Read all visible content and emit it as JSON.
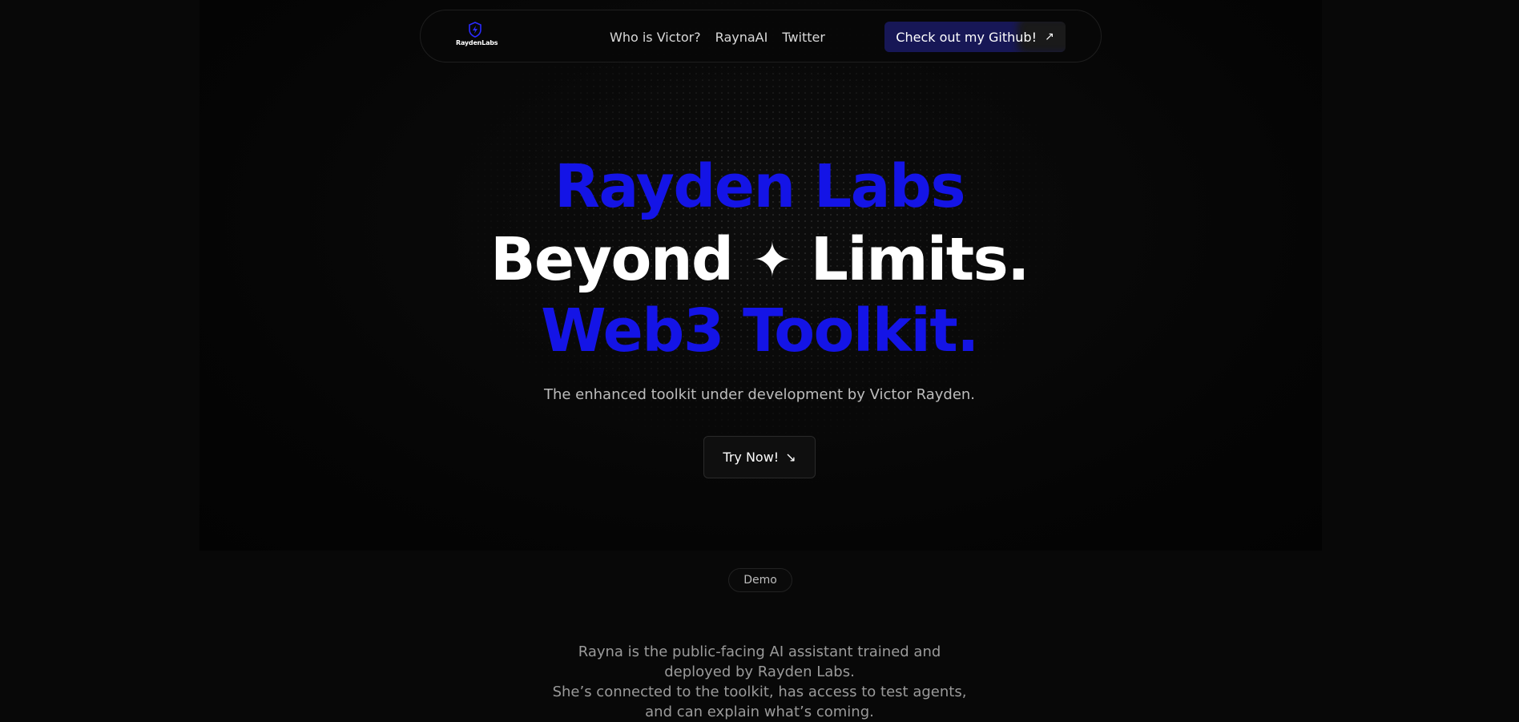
{
  "brand": {
    "logo_text": "RaydenLabs",
    "logo_icon": "shield-bolt-icon",
    "accent_color": "#1414e6"
  },
  "nav": {
    "links": [
      "Who is Victor?",
      "RaynaAI",
      "Twitter"
    ],
    "cta_label": "Check out my Github!",
    "cta_icon": "arrow-up-right-icon"
  },
  "hero": {
    "line1": "Rayden Labs",
    "line2_left": "Beyond",
    "line2_sparkle": "✦",
    "line2_right": "Limits.",
    "line3": "Web3 Toolkit.",
    "subtitle": "The enhanced toolkit under development by Victor Rayden.",
    "button_label": "Try Now!",
    "button_icon": "arrow-down-right-icon"
  },
  "demo": {
    "badge": "Demo",
    "description_lines": [
      "Rayna is the public-facing AI assistant trained and",
      "deployed by Rayden Labs.",
      "She’s connected to the toolkit, has access to test agents,",
      "and can explain what’s coming."
    ]
  }
}
